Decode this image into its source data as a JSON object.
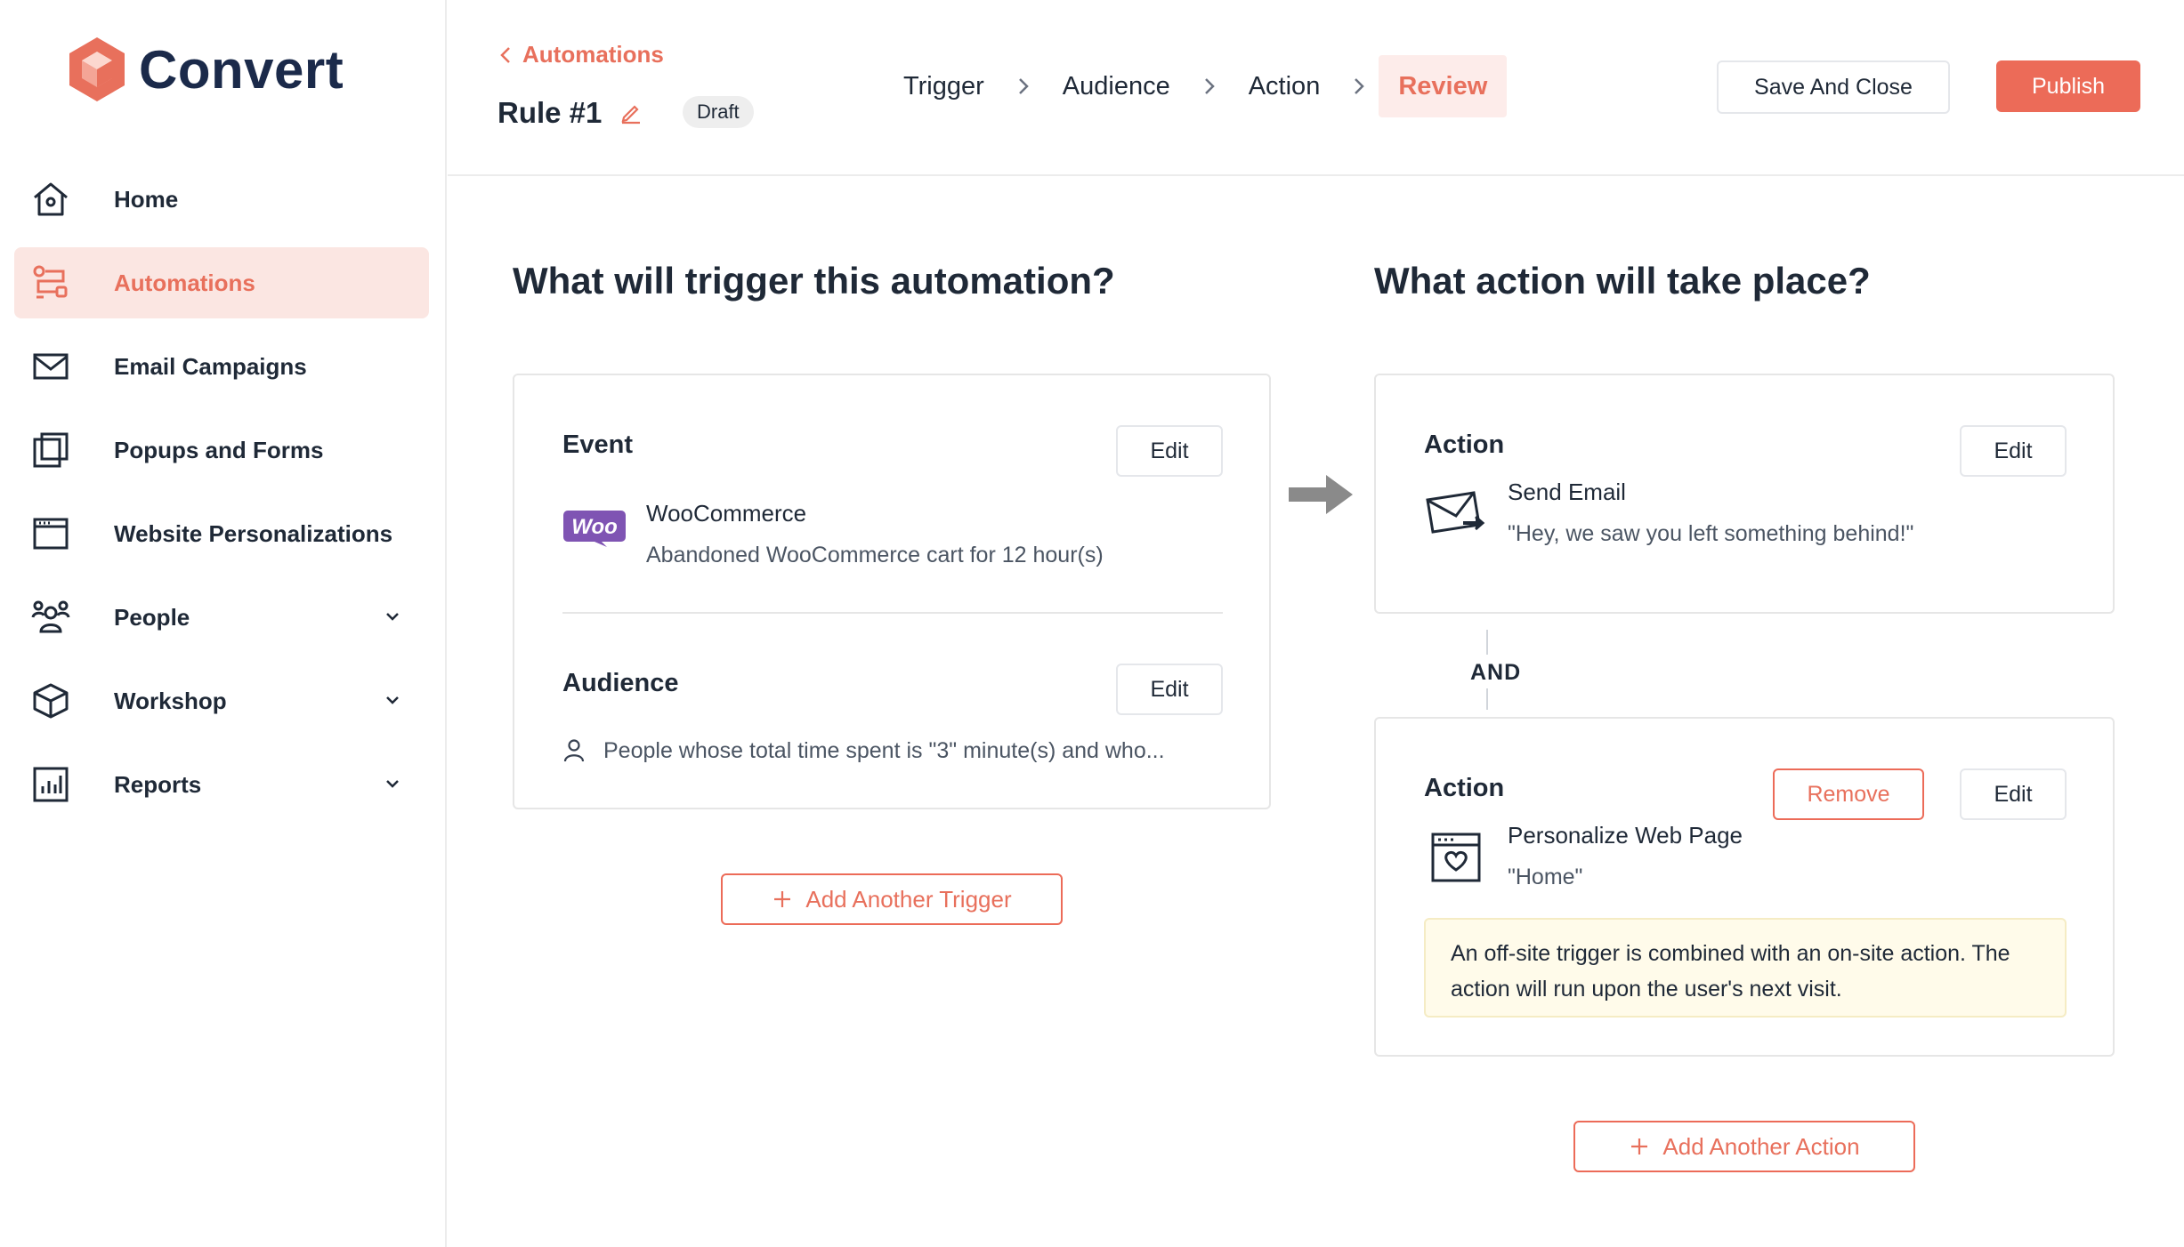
{
  "app": {
    "logo_text": "Convert",
    "brand_color": "#ec6b58"
  },
  "sidebar": {
    "items": [
      {
        "label": "Home",
        "icon": "home-icon"
      },
      {
        "label": "Automations",
        "icon": "automations-icon",
        "active": true
      },
      {
        "label": "Email Campaigns",
        "icon": "envelope-icon"
      },
      {
        "label": "Popups and Forms",
        "icon": "popup-icon"
      },
      {
        "label": "Website Personalizations",
        "icon": "browser-window-icon"
      },
      {
        "label": "People",
        "icon": "people-icon",
        "expandable": true
      },
      {
        "label": "Workshop",
        "icon": "box-icon",
        "expandable": true
      },
      {
        "label": "Reports",
        "icon": "bar-chart-icon",
        "expandable": true
      }
    ]
  },
  "header": {
    "back_label": "Automations",
    "rule_title": "Rule #1",
    "status_badge": "Draft",
    "steps": [
      "Trigger",
      "Audience",
      "Action",
      "Review"
    ],
    "active_step": "Review",
    "save_label": "Save And Close",
    "publish_label": "Publish"
  },
  "trigger_column": {
    "title": "What will trigger this automation?",
    "event": {
      "label": "Event",
      "edit_label": "Edit",
      "source": "WooCommerce",
      "source_logo_text": "Woo",
      "description": "Abandoned WooCommerce cart for 12 hour(s)"
    },
    "audience": {
      "label": "Audience",
      "edit_label": "Edit",
      "description": "People whose total time spent is \"3\" minute(s) and who..."
    },
    "add_label": "Add Another Trigger"
  },
  "action_column": {
    "title": "What action will take place?",
    "connector": "AND",
    "actions": [
      {
        "label": "Action",
        "edit_label": "Edit",
        "name": "Send Email",
        "detail": "\"Hey, we saw you left something behind!\"",
        "icon": "send-email-icon"
      },
      {
        "label": "Action",
        "edit_label": "Edit",
        "remove_label": "Remove",
        "name": "Personalize Web Page",
        "detail": "\"Home\"",
        "icon": "personalize-page-icon",
        "notice": "An off-site trigger is combined with an on-site action. The action will run upon the user's next visit."
      }
    ],
    "add_label": "Add Another Action"
  }
}
